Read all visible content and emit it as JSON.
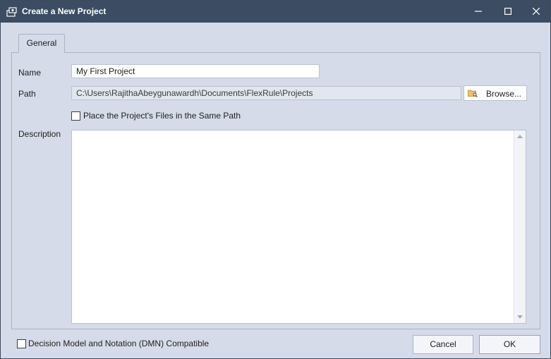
{
  "window": {
    "title": "Create a New Project",
    "minimize_icon": "minimize-icon",
    "maximize_icon": "maximize-icon",
    "close_icon": "close-icon"
  },
  "tabs": [
    {
      "label": "General",
      "selected": true
    }
  ],
  "form": {
    "name_label": "Name",
    "name_value": "My First Project",
    "path_label": "Path",
    "path_value": "C:\\Users\\RajithaAbeygunawardh\\Documents\\FlexRule\\Projects",
    "browse_label": "Browse...",
    "same_path_label": "Place the Project's Files in the Same Path",
    "same_path_checked": false,
    "description_label": "Description",
    "description_value": ""
  },
  "footer": {
    "dmn_label": "Decision Model and Notation (DMN) Compatible",
    "dmn_checked": false,
    "cancel_label": "Cancel",
    "ok_label": "OK"
  },
  "colors": {
    "titlebar": "#3b4c63",
    "dialog_bg": "#d6dbe9",
    "border": "#a9b3c7"
  }
}
